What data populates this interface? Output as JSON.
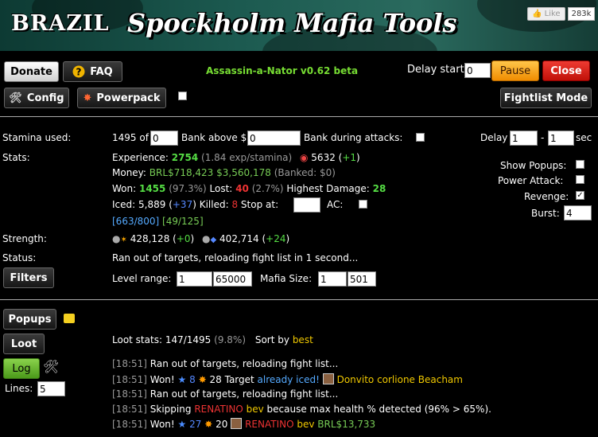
{
  "header": {
    "brand": "BRAZIL",
    "title": "Spockholm Mafia Tools",
    "like_label": "Like",
    "like_count": "283k"
  },
  "toolbar": {
    "donate": "Donate",
    "faq": "FAQ",
    "version": "Assassin-a-Nator v0.62 beta",
    "delay_start_label": "Delay start",
    "delay_start_value": "0",
    "pause": "Pause",
    "close": "Close",
    "config": "Config",
    "powerpack": "Powerpack",
    "fightlist_mode": "Fightlist Mode"
  },
  "stamina": {
    "label": "Stamina used:",
    "value": "1495 of",
    "limit": "0",
    "bank_above_label": "Bank above $",
    "bank_above_value": "0",
    "bank_during_label": "Bank during attacks:",
    "delay_label": "Delay",
    "delay_min": "1",
    "delay_max": "1",
    "delay_unit": "sec"
  },
  "stats": {
    "label": "Stats:",
    "experience_label": "Experience:",
    "experience_value": "2754",
    "exp_rate": "(1.84 exp/stamina)",
    "skill_value": "5632",
    "skill_delta": "+1",
    "money_label": "Money:",
    "money_brl": "BRL$718,423",
    "money_usd": "$3,560,178",
    "banked": "(Banked: $0)",
    "won_label": "Won:",
    "won_value": "1455",
    "won_pct": "(97.3%)",
    "lost_label": "Lost:",
    "lost_value": "40",
    "lost_pct": "(2.7%)",
    "highest_label": "Highest Damage:",
    "highest_value": "28",
    "iced_label": "Iced:",
    "iced_value": "5,889",
    "iced_delta": "+37",
    "killed_label": "Killed:",
    "killed_value": "8",
    "stop_at_label": "Stop at:",
    "stop_at_value": "",
    "ac_label": "AC:",
    "bracket1": "[663/800]",
    "bracket2": "[49/125]"
  },
  "options": {
    "show_popups": "Show Popups:",
    "power_attack": "Power Attack:",
    "revenge": "Revenge:",
    "burst": "Burst:",
    "burst_value": "4"
  },
  "strength": {
    "label": "Strength:",
    "attack": "428,128",
    "attack_delta": "+0",
    "defense": "402,714",
    "defense_delta": "+24"
  },
  "status": {
    "label": "Status:",
    "text": "Ran out of targets, reloading fight list in 1 second..."
  },
  "filters": {
    "button": "Filters",
    "level_label": "Level range:",
    "level_min": "1",
    "level_max": "65000",
    "mafia_label": "Mafia Size:",
    "mafia_min": "1",
    "mafia_max": "501"
  },
  "lower": {
    "popups": "Popups",
    "loot": "Loot",
    "log": "Log",
    "lines_label": "Lines:",
    "lines_value": "5",
    "loot_stats_label": "Loot stats:",
    "loot_stats_value": "147/1495",
    "loot_stats_pct": "(9.8%)",
    "sort_by_label": "Sort by",
    "sort_by_value": "best"
  },
  "log": [
    {
      "time": "[18:51]",
      "text": "Ran out of targets, reloading fight list..."
    },
    {
      "time": "[18:51]",
      "won": "Won!",
      "stars": "8",
      "bursts": "28",
      "pre": "Target",
      "note": "already iced!",
      "name": "Donvito corlione Beacham"
    },
    {
      "time": "[18:51]",
      "text": "Ran out of targets, reloading fight list..."
    },
    {
      "time": "[18:51]",
      "skip_pre": "Skipping",
      "skip_name1": "RENATINO",
      "skip_name2": "bev",
      "skip_post": "because max health % detected (96% > 65%)."
    },
    {
      "time": "[18:51]",
      "won": "Won!",
      "stars": "27",
      "bursts": "20",
      "name1": "RENATINO",
      "name2": "bev",
      "loot": "BRL$13,733"
    }
  ],
  "colors": {
    "green": "#55dd44",
    "red": "#ee3333",
    "blue": "#5588ff",
    "gold": "#f0c800"
  }
}
